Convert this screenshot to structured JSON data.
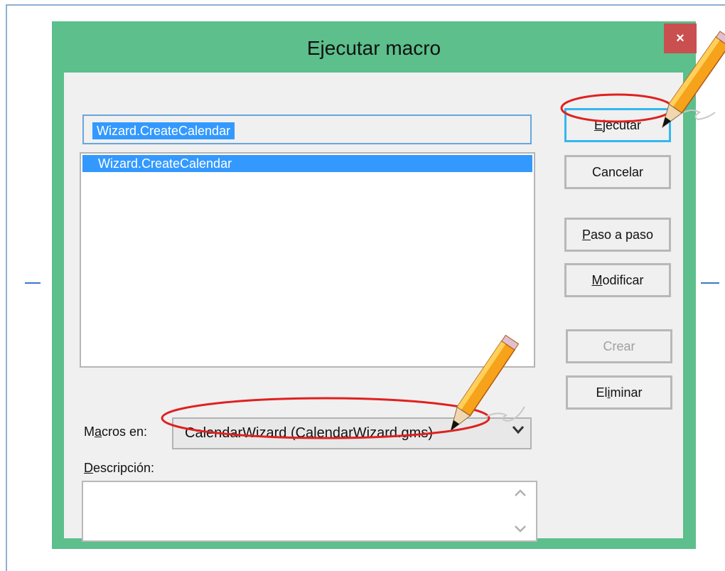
{
  "window": {
    "title": "Ejecutar macro",
    "close_glyph": "×"
  },
  "macro_name": {
    "value": "Wizard.CreateCalendar"
  },
  "macro_list": {
    "items": [
      "Wizard.CreateCalendar"
    ],
    "selected_index": 0
  },
  "buttons": {
    "run": {
      "prefix": "",
      "mnemonic": "E",
      "rest": "jecutar"
    },
    "cancel": {
      "label": "Cancelar"
    },
    "step": {
      "prefix": "",
      "mnemonic": "P",
      "rest": "aso a paso"
    },
    "edit": {
      "prefix": "",
      "mnemonic": "M",
      "rest": "odificar"
    },
    "create": {
      "label": "Crear",
      "enabled": false
    },
    "delete": {
      "prefix": "El",
      "mnemonic": "i",
      "rest": "minar"
    }
  },
  "macros_in": {
    "label_prefix": "M",
    "label_mnemonic": "a",
    "label_rest": "cros en:",
    "value": "CalendarWizard (CalendarWizard.gms)"
  },
  "description": {
    "label_mnemonic": "D",
    "label_rest": "escripción:",
    "value": ""
  },
  "icons": [
    "close-icon",
    "chevron-down-icon",
    "scroll-up-icon",
    "scroll-down-icon",
    "pencil-icon"
  ],
  "colors": {
    "window_frame": "#5cbf8c",
    "close_button": "#c9504f",
    "selection": "#3399ff",
    "annotation_ring": "#e02020"
  }
}
